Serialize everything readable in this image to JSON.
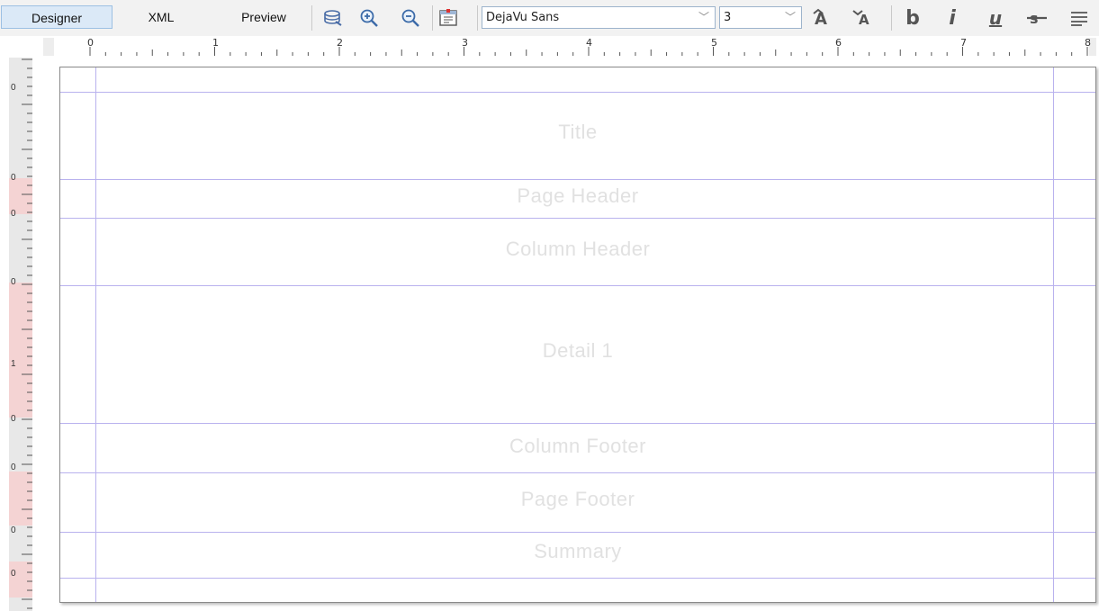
{
  "toolbar": {
    "tabs": [
      {
        "label": "Designer",
        "active": true
      },
      {
        "label": "XML",
        "active": false
      },
      {
        "label": "Preview",
        "active": false
      }
    ],
    "font_family_value": "DejaVu Sans",
    "font_size_value": "3",
    "icons": [
      "datasource-icon",
      "zoom-in-icon",
      "zoom-out-icon",
      "report-properties-icon",
      "increase-font-icon",
      "decrease-font-icon",
      "bold-icon",
      "italic-icon",
      "underline-icon",
      "strikethrough-icon",
      "align-icon"
    ],
    "format_glyphs": {
      "bold": "b",
      "italic": "i",
      "underline": "u"
    }
  },
  "ruler": {
    "numbers": [
      "0",
      "1",
      "2",
      "3",
      "4",
      "5",
      "6",
      "7",
      "8"
    ],
    "vertical_numbers": [
      "0",
      "0",
      "0",
      "0",
      "1",
      "0",
      "0",
      "0",
      "0"
    ]
  },
  "bands": [
    {
      "name": "Title"
    },
    {
      "name": "Page Header"
    },
    {
      "name": "Column Header"
    },
    {
      "name": "Detail 1"
    },
    {
      "name": "Column Footer"
    },
    {
      "name": "Page Footer"
    },
    {
      "name": "Summary"
    }
  ],
  "colors": {
    "guide_line": "#b9b2ee",
    "band_label": "#e1e1e1",
    "active_tab": "#dbe9f7",
    "ruler_margin": "#f4d3d3"
  }
}
